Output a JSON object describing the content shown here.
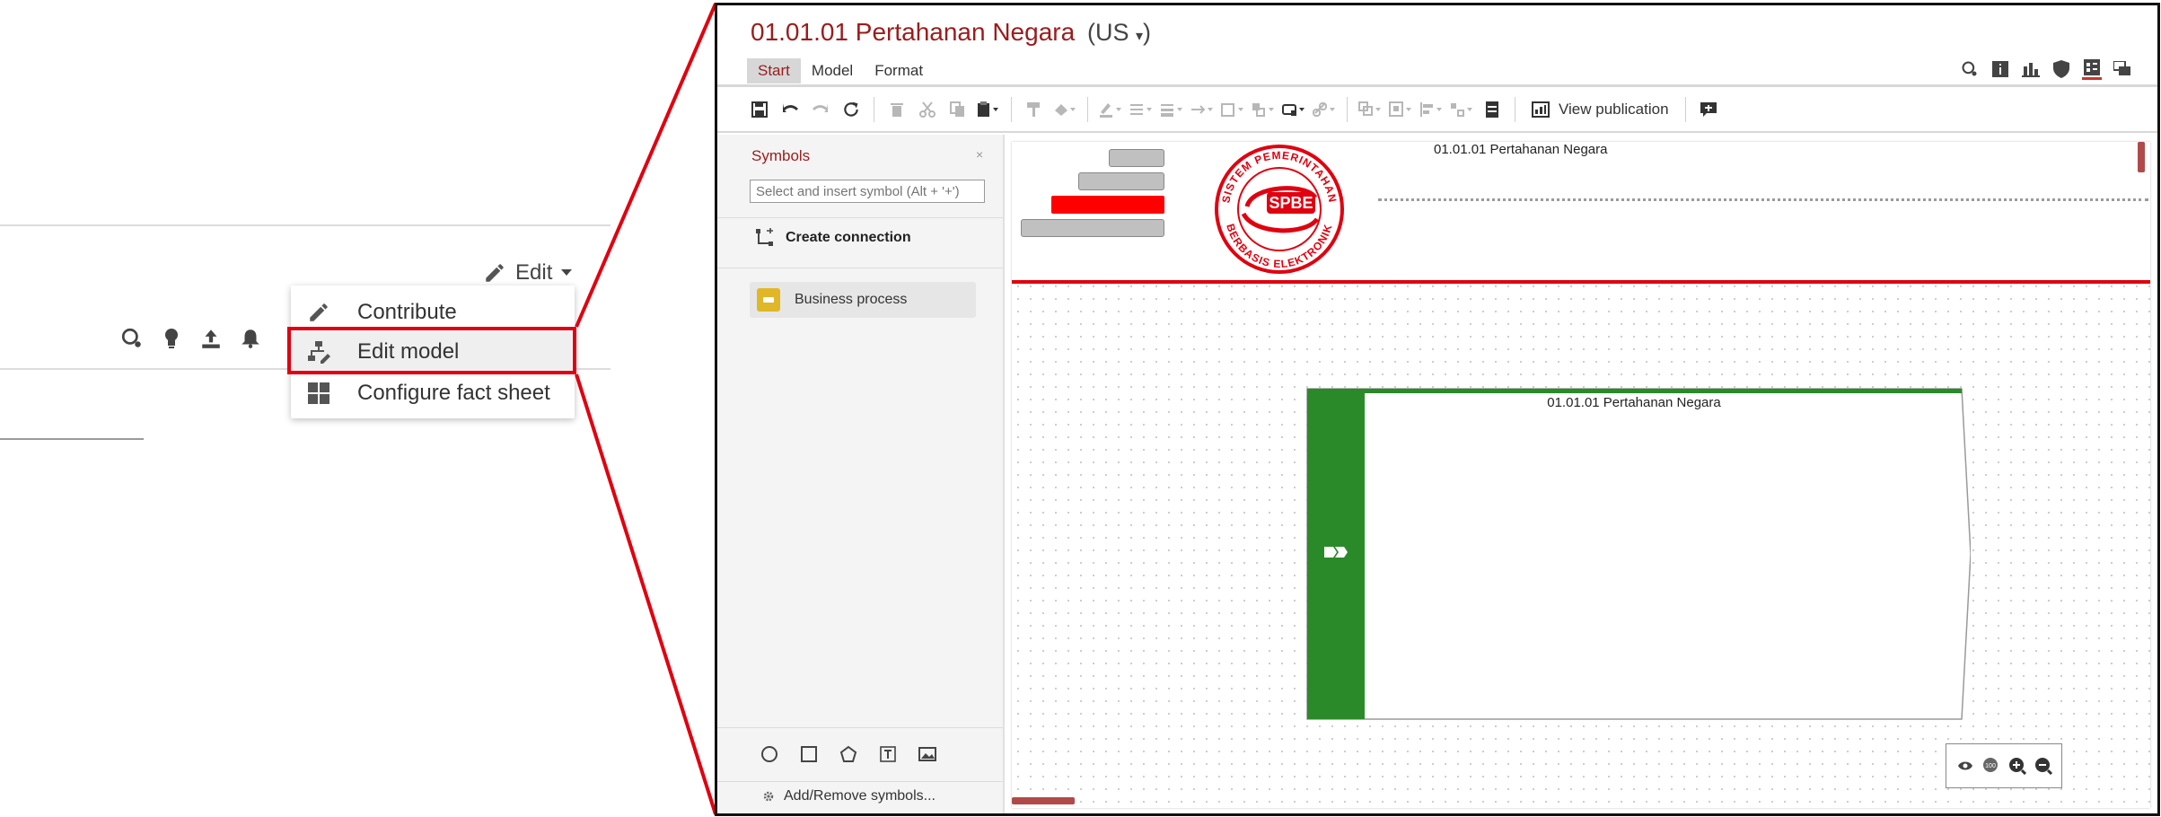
{
  "left_panel": {
    "edit_label": "Edit",
    "menu_items": [
      {
        "label": "Contribute",
        "icon": "pencil-icon"
      },
      {
        "label": "Edit model",
        "icon": "model-edit-icon"
      },
      {
        "label": "Configure fact sheet",
        "icon": "grid-icon"
      }
    ],
    "toolbar_icons": [
      "search-icon",
      "lightbulb-icon",
      "upload-icon",
      "bell-icon"
    ]
  },
  "editor": {
    "title": "01.01.01 Pertahanan Negara",
    "language": "(US",
    "tabs": [
      "Start",
      "Model",
      "Format"
    ],
    "active_tab": "Start",
    "view_publication_label": "View publication",
    "symbols_panel": {
      "title": "Symbols",
      "close": "×",
      "search_placeholder": "Select and insert symbol (Alt + '+')",
      "create_connection": "Create connection",
      "business_process": "Business process",
      "add_remove": "Add/Remove symbols..."
    },
    "canvas": {
      "header_title": "01.01.01 Pertahanan Negara",
      "logo_text": "SPBE",
      "logo_ring_top": "SISTEM PEMERINTAHAN",
      "logo_ring_bottom": "BERBASIS ELEKTRONIK",
      "process_title": "01.01.01 Pertahanan Negara"
    },
    "colors": {
      "accent": "#9b1c1c",
      "highlight_red": "#e0000f",
      "process_green": "#2a8a2a",
      "business_process_yellow": "#e0b729"
    }
  }
}
